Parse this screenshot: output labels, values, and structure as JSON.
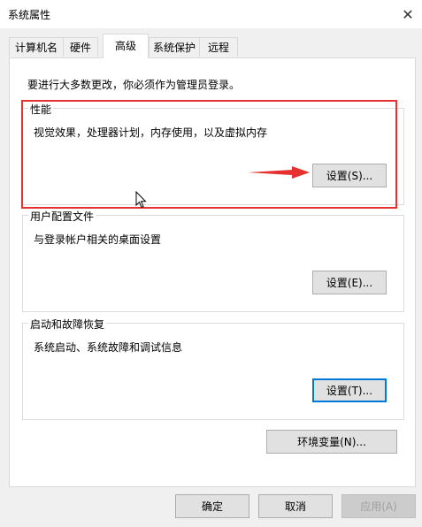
{
  "window": {
    "title": "系统属性"
  },
  "tabs": [
    {
      "label": "计算机名"
    },
    {
      "label": "硬件"
    },
    {
      "label": "高级"
    },
    {
      "label": "系统保护"
    },
    {
      "label": "远程"
    }
  ],
  "active_tab": "高级",
  "advanced": {
    "admin_note": "要进行大多数更改，你必须作为管理员登录。",
    "performance": {
      "label": "性能",
      "description": "视觉效果，处理器计划，内存使用，以及虚拟内存",
      "button": "设置(S)..."
    },
    "user_profiles": {
      "label": "用户配置文件",
      "description": "与登录帐户相关的桌面设置",
      "button": "设置(E)..."
    },
    "startup_recovery": {
      "label": "启动和故障恢复",
      "description": "系统启动、系统故障和调试信息",
      "button": "设置(T)..."
    },
    "env_button": "环境变量(N)..."
  },
  "footer": {
    "ok": "确定",
    "cancel": "取消",
    "apply": "应用(A)"
  },
  "annotation": {
    "highlight_color": "#e5312f"
  }
}
